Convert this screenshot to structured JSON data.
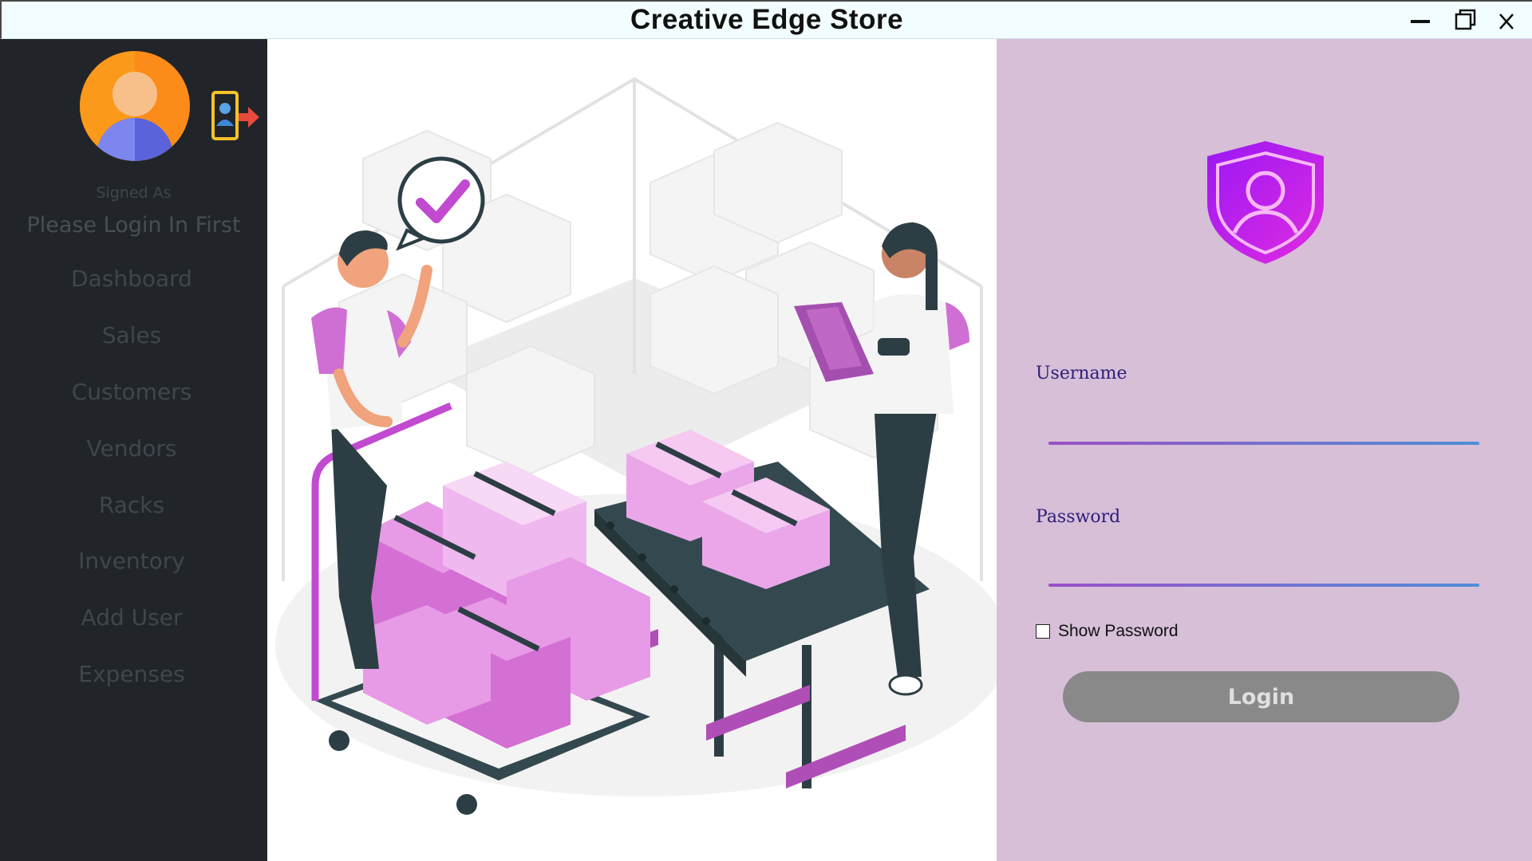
{
  "window": {
    "title": "Creative Edge Store",
    "controls": {
      "minimize": "minimize-icon",
      "maximize": "maximize-icon",
      "close": "close-icon"
    }
  },
  "sidebar": {
    "signed_as_label": "Signed As",
    "login_status": "Please Login In First",
    "avatar_icon": "user-avatar-icon",
    "logout_icon": "logout-icon",
    "items": [
      {
        "label": "Dashboard"
      },
      {
        "label": "Sales"
      },
      {
        "label": "Customers"
      },
      {
        "label": "Vendors"
      },
      {
        "label": "Racks"
      },
      {
        "label": "Inventory"
      },
      {
        "label": "Add User"
      },
      {
        "label": "Expenses"
      }
    ]
  },
  "login": {
    "shield_icon": "user-shield-icon",
    "username_label": "Username",
    "username_value": "",
    "password_label": "Password",
    "password_value": "",
    "show_password_label": "Show Password",
    "show_password_checked": false,
    "login_button_label": "Login"
  },
  "colors": {
    "sidebar_bg": "#212529",
    "login_panel_bg": "#d7bfd8",
    "accent_purple": "#c14ad0",
    "login_button_bg": "#898989",
    "label_color": "#2d1d7a"
  }
}
